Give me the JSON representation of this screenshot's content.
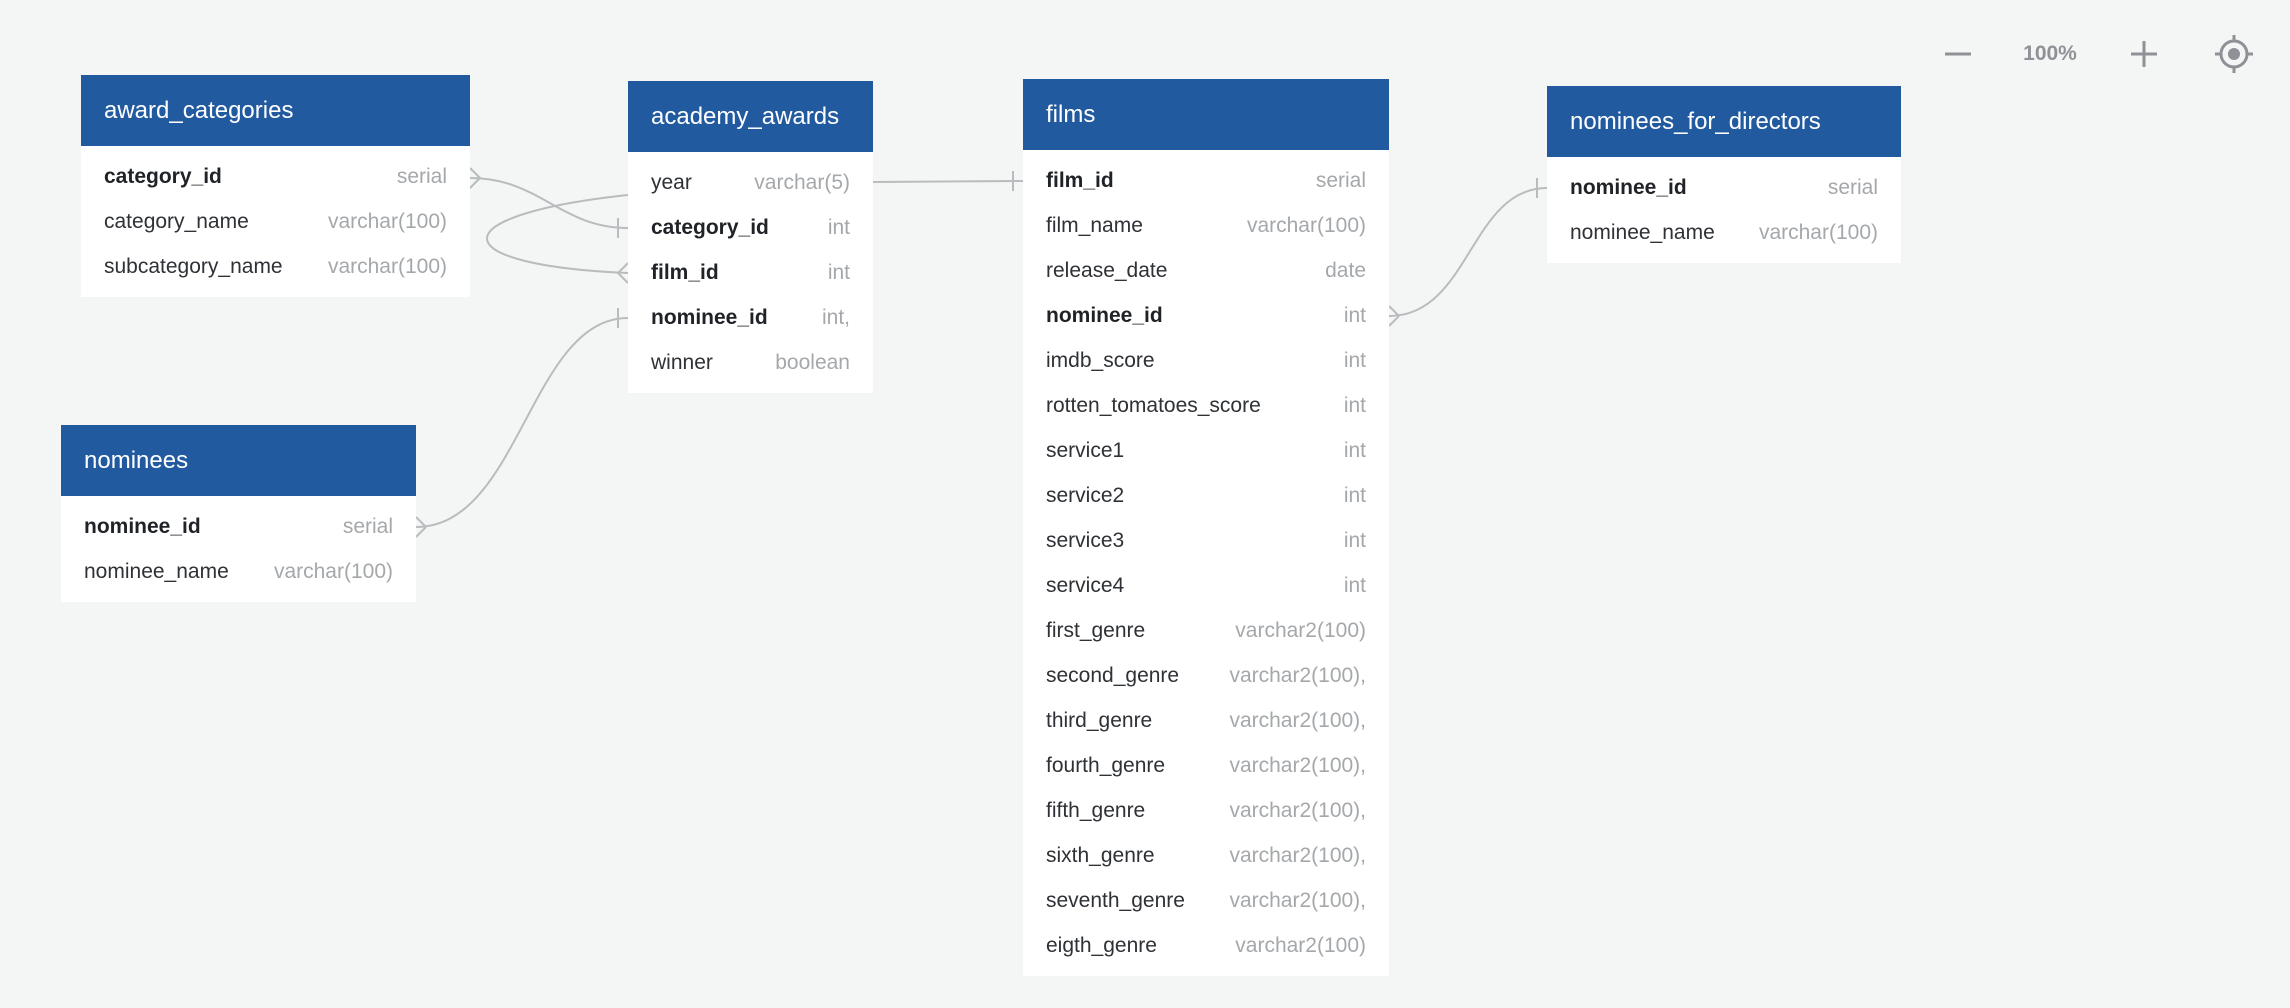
{
  "zoom": {
    "level": "100%"
  },
  "colors": {
    "header": "#225aa0",
    "background": "#f4f5f5",
    "connector": "#b9bcbe"
  },
  "icons": {
    "zoom_out": "minus-icon",
    "zoom_in": "plus-icon",
    "recenter": "target-icon"
  },
  "tables": [
    {
      "id": "award_categories",
      "name": "award_categories",
      "fields": [
        {
          "name": "category_id",
          "type": "serial",
          "pk": true
        },
        {
          "name": "category_name",
          "type": "varchar(100)",
          "pk": false
        },
        {
          "name": "subcategory_name",
          "type": "varchar(100)",
          "pk": false
        }
      ]
    },
    {
      "id": "academy_awards",
      "name": "academy_awards",
      "fields": [
        {
          "name": "year",
          "type": "varchar(5)",
          "pk": false
        },
        {
          "name": "category_id",
          "type": "int",
          "pk": true
        },
        {
          "name": "film_id",
          "type": "int",
          "pk": true
        },
        {
          "name": "nominee_id",
          "type": "int,",
          "pk": true
        },
        {
          "name": "winner",
          "type": "boolean",
          "pk": false
        }
      ]
    },
    {
      "id": "films",
      "name": "films",
      "fields": [
        {
          "name": "film_id",
          "type": "serial",
          "pk": true
        },
        {
          "name": "film_name",
          "type": "varchar(100)",
          "pk": false
        },
        {
          "name": "release_date",
          "type": "date",
          "pk": false
        },
        {
          "name": "nominee_id",
          "type": "int",
          "pk": true
        },
        {
          "name": "imdb_score",
          "type": "int",
          "pk": false
        },
        {
          "name": "rotten_tomatoes_score",
          "type": "int",
          "pk": false
        },
        {
          "name": "service1",
          "type": "int",
          "pk": false
        },
        {
          "name": "service2",
          "type": "int",
          "pk": false
        },
        {
          "name": "service3",
          "type": "int",
          "pk": false
        },
        {
          "name": "service4",
          "type": "int",
          "pk": false
        },
        {
          "name": "first_genre",
          "type": "varchar2(100)",
          "pk": false
        },
        {
          "name": "second_genre",
          "type": "varchar2(100),",
          "pk": false
        },
        {
          "name": "third_genre",
          "type": "varchar2(100),",
          "pk": false
        },
        {
          "name": "fourth_genre",
          "type": "varchar2(100),",
          "pk": false
        },
        {
          "name": "fifth_genre",
          "type": "varchar2(100),",
          "pk": false
        },
        {
          "name": "sixth_genre",
          "type": "varchar2(100),",
          "pk": false
        },
        {
          "name": "seventh_genre",
          "type": "varchar2(100),",
          "pk": false
        },
        {
          "name": "eigth_genre",
          "type": "varchar2(100)",
          "pk": false
        }
      ]
    },
    {
      "id": "nominees_for_directors",
      "name": "nominees_for_directors",
      "fields": [
        {
          "name": "nominee_id",
          "type": "serial",
          "pk": true
        },
        {
          "name": "nominee_name",
          "type": "varchar(100)",
          "pk": false
        }
      ]
    },
    {
      "id": "nominees",
      "name": "nominees",
      "fields": [
        {
          "name": "nominee_id",
          "type": "serial",
          "pk": true
        },
        {
          "name": "nominee_name",
          "type": "varchar(100)",
          "pk": false
        }
      ]
    }
  ]
}
